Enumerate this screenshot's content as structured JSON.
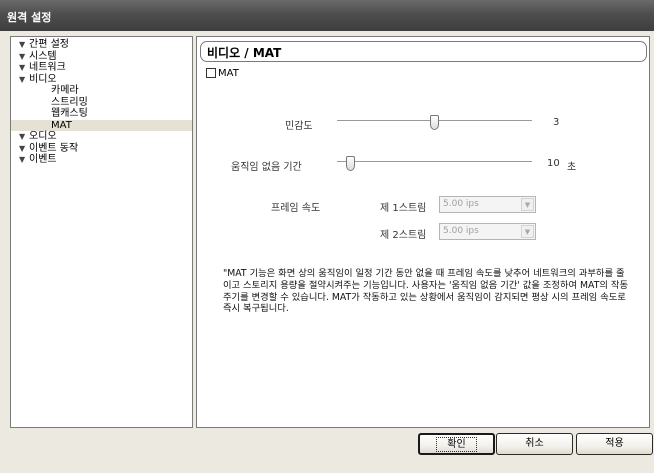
{
  "window": {
    "title": "원격 설정"
  },
  "tree": {
    "items": [
      {
        "label": "간편 설정",
        "expanded": true
      },
      {
        "label": "시스템",
        "expanded": true
      },
      {
        "label": "네트워크",
        "expanded": true
      },
      {
        "label": "비디오",
        "expanded": true
      },
      {
        "label": "카메라"
      },
      {
        "label": "스트리밍"
      },
      {
        "label": "웹캐스팅"
      },
      {
        "label": "MAT",
        "selected": true
      },
      {
        "label": "오디오",
        "expanded": true
      },
      {
        "label": "이벤트 동작",
        "expanded": true
      },
      {
        "label": "이벤트",
        "expanded": true
      }
    ]
  },
  "panel": {
    "title": "비디오 / MAT",
    "mat_label": "MAT",
    "mat_checked": false,
    "sensitivity": {
      "label": "민감도",
      "value": "3",
      "level": 0.5
    },
    "motionless": {
      "label": "움직임 없음 기간",
      "value": "10",
      "unit": "초",
      "level": 0.05
    },
    "framerate": {
      "label": "프레임 속도",
      "stream1": {
        "label": "제 1스트림",
        "value": "5.00 ips"
      },
      "stream2": {
        "label": "제 2스트림",
        "value": "5.00 ips"
      }
    },
    "note": "\"MAT 기능은 화면 상의 움직임이 일정 기간 동안 없을 때 프레임 속도를 낮추어 네트워크의 과부하를 줄이고 스토리지 용량을 절약시켜주는 기능입니다. 사용자는 '움직임 없음 기간' 값을 조정하여 MAT의 작동 주기를 변경할 수 있습니다. MAT가 작동하고 있는 상황에서 움직임이 감지되면 평상 시의 프레임 속도로 즉시 복구됩니다."
  },
  "buttons": {
    "ok": "확인",
    "cancel": "취소",
    "apply": "적용"
  },
  "icons": {
    "expand": "triangle-down-icon",
    "dropdown": "chevron-down-icon"
  }
}
